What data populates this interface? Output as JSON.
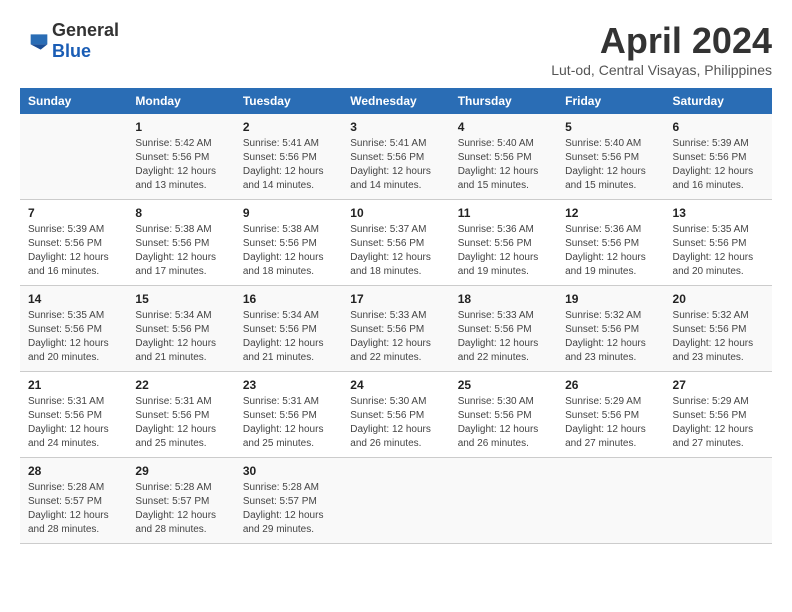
{
  "header": {
    "logo": {
      "general": "General",
      "blue": "Blue"
    },
    "title": "April 2024",
    "subtitle": "Lut-od, Central Visayas, Philippines"
  },
  "calendar": {
    "weekdays": [
      "Sunday",
      "Monday",
      "Tuesday",
      "Wednesday",
      "Thursday",
      "Friday",
      "Saturday"
    ],
    "weeks": [
      [
        {
          "day": "",
          "sunrise": "",
          "sunset": "",
          "daylight": ""
        },
        {
          "day": "1",
          "sunrise": "Sunrise: 5:42 AM",
          "sunset": "Sunset: 5:56 PM",
          "daylight": "Daylight: 12 hours and 13 minutes."
        },
        {
          "day": "2",
          "sunrise": "Sunrise: 5:41 AM",
          "sunset": "Sunset: 5:56 PM",
          "daylight": "Daylight: 12 hours and 14 minutes."
        },
        {
          "day": "3",
          "sunrise": "Sunrise: 5:41 AM",
          "sunset": "Sunset: 5:56 PM",
          "daylight": "Daylight: 12 hours and 14 minutes."
        },
        {
          "day": "4",
          "sunrise": "Sunrise: 5:40 AM",
          "sunset": "Sunset: 5:56 PM",
          "daylight": "Daylight: 12 hours and 15 minutes."
        },
        {
          "day": "5",
          "sunrise": "Sunrise: 5:40 AM",
          "sunset": "Sunset: 5:56 PM",
          "daylight": "Daylight: 12 hours and 15 minutes."
        },
        {
          "day": "6",
          "sunrise": "Sunrise: 5:39 AM",
          "sunset": "Sunset: 5:56 PM",
          "daylight": "Daylight: 12 hours and 16 minutes."
        }
      ],
      [
        {
          "day": "7",
          "sunrise": "Sunrise: 5:39 AM",
          "sunset": "Sunset: 5:56 PM",
          "daylight": "Daylight: 12 hours and 16 minutes."
        },
        {
          "day": "8",
          "sunrise": "Sunrise: 5:38 AM",
          "sunset": "Sunset: 5:56 PM",
          "daylight": "Daylight: 12 hours and 17 minutes."
        },
        {
          "day": "9",
          "sunrise": "Sunrise: 5:38 AM",
          "sunset": "Sunset: 5:56 PM",
          "daylight": "Daylight: 12 hours and 18 minutes."
        },
        {
          "day": "10",
          "sunrise": "Sunrise: 5:37 AM",
          "sunset": "Sunset: 5:56 PM",
          "daylight": "Daylight: 12 hours and 18 minutes."
        },
        {
          "day": "11",
          "sunrise": "Sunrise: 5:36 AM",
          "sunset": "Sunset: 5:56 PM",
          "daylight": "Daylight: 12 hours and 19 minutes."
        },
        {
          "day": "12",
          "sunrise": "Sunrise: 5:36 AM",
          "sunset": "Sunset: 5:56 PM",
          "daylight": "Daylight: 12 hours and 19 minutes."
        },
        {
          "day": "13",
          "sunrise": "Sunrise: 5:35 AM",
          "sunset": "Sunset: 5:56 PM",
          "daylight": "Daylight: 12 hours and 20 minutes."
        }
      ],
      [
        {
          "day": "14",
          "sunrise": "Sunrise: 5:35 AM",
          "sunset": "Sunset: 5:56 PM",
          "daylight": "Daylight: 12 hours and 20 minutes."
        },
        {
          "day": "15",
          "sunrise": "Sunrise: 5:34 AM",
          "sunset": "Sunset: 5:56 PM",
          "daylight": "Daylight: 12 hours and 21 minutes."
        },
        {
          "day": "16",
          "sunrise": "Sunrise: 5:34 AM",
          "sunset": "Sunset: 5:56 PM",
          "daylight": "Daylight: 12 hours and 21 minutes."
        },
        {
          "day": "17",
          "sunrise": "Sunrise: 5:33 AM",
          "sunset": "Sunset: 5:56 PM",
          "daylight": "Daylight: 12 hours and 22 minutes."
        },
        {
          "day": "18",
          "sunrise": "Sunrise: 5:33 AM",
          "sunset": "Sunset: 5:56 PM",
          "daylight": "Daylight: 12 hours and 22 minutes."
        },
        {
          "day": "19",
          "sunrise": "Sunrise: 5:32 AM",
          "sunset": "Sunset: 5:56 PM",
          "daylight": "Daylight: 12 hours and 23 minutes."
        },
        {
          "day": "20",
          "sunrise": "Sunrise: 5:32 AM",
          "sunset": "Sunset: 5:56 PM",
          "daylight": "Daylight: 12 hours and 23 minutes."
        }
      ],
      [
        {
          "day": "21",
          "sunrise": "Sunrise: 5:31 AM",
          "sunset": "Sunset: 5:56 PM",
          "daylight": "Daylight: 12 hours and 24 minutes."
        },
        {
          "day": "22",
          "sunrise": "Sunrise: 5:31 AM",
          "sunset": "Sunset: 5:56 PM",
          "daylight": "Daylight: 12 hours and 25 minutes."
        },
        {
          "day": "23",
          "sunrise": "Sunrise: 5:31 AM",
          "sunset": "Sunset: 5:56 PM",
          "daylight": "Daylight: 12 hours and 25 minutes."
        },
        {
          "day": "24",
          "sunrise": "Sunrise: 5:30 AM",
          "sunset": "Sunset: 5:56 PM",
          "daylight": "Daylight: 12 hours and 26 minutes."
        },
        {
          "day": "25",
          "sunrise": "Sunrise: 5:30 AM",
          "sunset": "Sunset: 5:56 PM",
          "daylight": "Daylight: 12 hours and 26 minutes."
        },
        {
          "day": "26",
          "sunrise": "Sunrise: 5:29 AM",
          "sunset": "Sunset: 5:56 PM",
          "daylight": "Daylight: 12 hours and 27 minutes."
        },
        {
          "day": "27",
          "sunrise": "Sunrise: 5:29 AM",
          "sunset": "Sunset: 5:56 PM",
          "daylight": "Daylight: 12 hours and 27 minutes."
        }
      ],
      [
        {
          "day": "28",
          "sunrise": "Sunrise: 5:28 AM",
          "sunset": "Sunset: 5:57 PM",
          "daylight": "Daylight: 12 hours and 28 minutes."
        },
        {
          "day": "29",
          "sunrise": "Sunrise: 5:28 AM",
          "sunset": "Sunset: 5:57 PM",
          "daylight": "Daylight: 12 hours and 28 minutes."
        },
        {
          "day": "30",
          "sunrise": "Sunrise: 5:28 AM",
          "sunset": "Sunset: 5:57 PM",
          "daylight": "Daylight: 12 hours and 29 minutes."
        },
        {
          "day": "",
          "sunrise": "",
          "sunset": "",
          "daylight": ""
        },
        {
          "day": "",
          "sunrise": "",
          "sunset": "",
          "daylight": ""
        },
        {
          "day": "",
          "sunrise": "",
          "sunset": "",
          "daylight": ""
        },
        {
          "day": "",
          "sunrise": "",
          "sunset": "",
          "daylight": ""
        }
      ]
    ]
  }
}
